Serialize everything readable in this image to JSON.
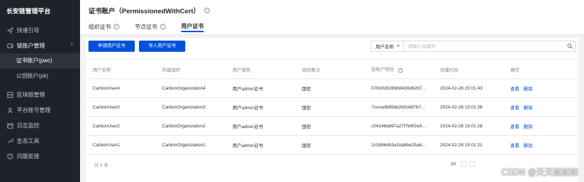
{
  "sidebar": {
    "brand": "长安链管理平台",
    "items": [
      {
        "label": "快速引导",
        "icon": "send-icon"
      },
      {
        "label": "链账户管理",
        "icon": "wallet-icon",
        "chevron": "^"
      },
      {
        "label": "区块链管理",
        "icon": "blockchain-icon"
      },
      {
        "label": "平台账号管理",
        "icon": "user-icon"
      },
      {
        "label": "日志监控",
        "icon": "calendar-icon"
      },
      {
        "label": "生态工具",
        "icon": "tools-icon"
      },
      {
        "label": "问题反馈",
        "icon": "help-icon"
      }
    ],
    "sub_items": [
      {
        "label": "证书账户(pwc)"
      },
      {
        "label": "公钥账户(pk)"
      }
    ]
  },
  "header": {
    "title": "证书账户（PermissionedWithCert）",
    "tabs": [
      {
        "label": "组织证书"
      },
      {
        "label": "节点证书"
      },
      {
        "label": "用户证书"
      }
    ]
  },
  "toolbar": {
    "apply_label": "申请用户证书",
    "import_label": "导入用户证书",
    "search_field": "用户名称",
    "search_placeholder": "请输入关键词"
  },
  "table": {
    "columns": [
      "用户名称",
      "所属组织",
      "用户角色",
      "密码算法",
      "链账户地址",
      "创建时间",
      "操作"
    ],
    "rows": [
      {
        "name": "CarbonUser4",
        "org": "CarbonOrganization4",
        "role": "用户admin证书",
        "algo": "国密",
        "address": "07630d0269b8430d6287...",
        "created": "2024-02-28 15:01:43",
        "view": "查看",
        "delete": "删除"
      },
      {
        "name": "CarbonUser3",
        "org": "CarbonOrganization3",
        "role": "用户admin证书",
        "algo": "国密",
        "address": "7ccced685bb2b0c687b7...",
        "created": "2024-02-28 15:01:36",
        "view": "查看",
        "delete": "删除"
      },
      {
        "name": "CarbonUser2",
        "org": "CarbonOrganization2",
        "role": "用户admin证书",
        "algo": "国密",
        "address": "c04148dd97a27f7b6f2e9...",
        "created": "2024-02-28 15:01:28",
        "view": "查看",
        "delete": "删除"
      },
      {
        "name": "CarbonUser1",
        "org": "CarbonOrganization1",
        "role": "用户admin证书",
        "algo": "国密",
        "address": "2c3d864b3a1ba6be25a6...",
        "created": "2024-02-28 15:01:21",
        "view": "查看",
        "delete": "删除"
      }
    ]
  },
  "footer": {
    "total": "共 4 条",
    "page_size": "10"
  },
  "watermark": "CSDN @天天敲敲敲",
  "colors": {
    "accent": "#0052d9",
    "sidebar_bg": "#1f2329"
  }
}
